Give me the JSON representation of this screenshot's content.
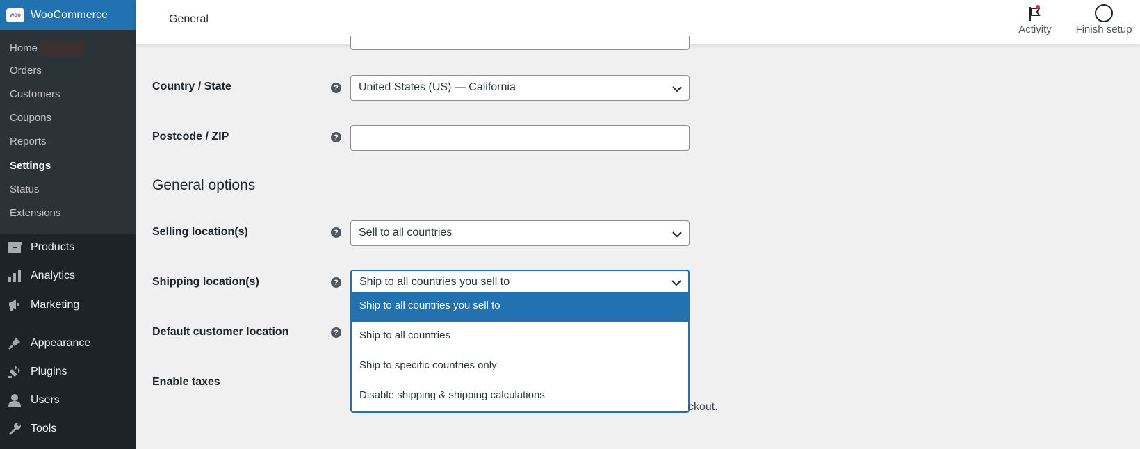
{
  "sidebar": {
    "brand": "WooCommerce",
    "submenu": [
      {
        "label": "Home"
      },
      {
        "label": "Orders"
      },
      {
        "label": "Customers"
      },
      {
        "label": "Coupons"
      },
      {
        "label": "Reports"
      },
      {
        "label": "Settings",
        "active": true
      },
      {
        "label": "Status"
      },
      {
        "label": "Extensions"
      }
    ],
    "menu": [
      {
        "label": "Products",
        "icon": "products-icon"
      },
      {
        "label": "Analytics",
        "icon": "analytics-icon"
      },
      {
        "label": "Marketing",
        "icon": "marketing-icon"
      },
      {
        "label": "Appearance",
        "icon": "appearance-icon"
      },
      {
        "label": "Plugins",
        "icon": "plugins-icon"
      },
      {
        "label": "Users",
        "icon": "users-icon"
      },
      {
        "label": "Tools",
        "icon": "tools-icon"
      }
    ]
  },
  "header": {
    "title": "General",
    "activity_label": "Activity",
    "finish_setup_label": "Finish setup"
  },
  "form": {
    "country_state": {
      "label": "Country / State",
      "value": "United States (US) — California"
    },
    "postcode": {
      "label": "Postcode / ZIP",
      "value": ""
    },
    "section_title": "General options",
    "selling_locations": {
      "label": "Selling location(s)",
      "value": "Sell to all countries"
    },
    "shipping_locations": {
      "label": "Shipping location(s)",
      "value": "Ship to all countries you sell to",
      "options": [
        "Ship to all countries you sell to",
        "Ship to all countries",
        "Ship to specific countries only",
        "Disable shipping & shipping calculations"
      ]
    },
    "default_customer_location": {
      "label": "Default customer location"
    },
    "enable_taxes": {
      "label": "Enable taxes",
      "trailing_text": "ckout."
    }
  },
  "colors": {
    "accent": "#2271b1",
    "sidebar_bg": "#1d2327",
    "submenu_bg": "#2c3338",
    "page_bg": "#f0f0f1"
  }
}
